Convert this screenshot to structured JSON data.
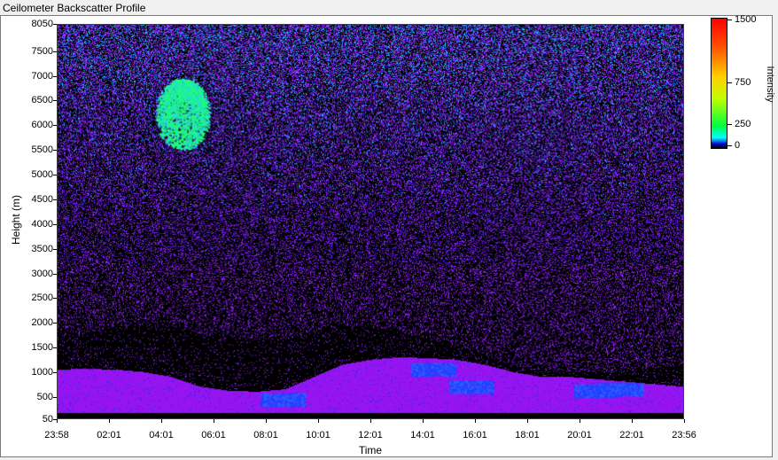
{
  "window": {
    "title": "Ceilometer Backscatter Profile"
  },
  "chart_data": {
    "type": "heatmap",
    "title": "Ceilometer Backscatter Profile",
    "xlabel": "Time",
    "ylabel": "Height (m)",
    "x_ticks": [
      "23:58",
      "02:01",
      "04:01",
      "06:01",
      "08:01",
      "10:01",
      "12:01",
      "14:01",
      "16:01",
      "18:01",
      "20:01",
      "22:01",
      "23:56"
    ],
    "y_ticks": [
      "8050",
      "7500",
      "7000",
      "6500",
      "6000",
      "5500",
      "5000",
      "4500",
      "4000",
      "3500",
      "3000",
      "2500",
      "2000",
      "1500",
      "1000",
      "500",
      "50"
    ],
    "ylim": [
      50,
      8050
    ],
    "colorbar": {
      "label": "Intensity",
      "ticks": [
        "1500",
        "750",
        "250",
        "0"
      ],
      "range": [
        0,
        1500
      ],
      "colors": [
        "#000000",
        "#0000c8",
        "#00ffff",
        "#00ff40",
        "#c0ff00",
        "#ffd000",
        "#ff5000",
        "#ff0000"
      ]
    },
    "features": {
      "boundary_layer_top_m": [
        1050,
        1060,
        1050,
        1000,
        900,
        700,
        620,
        600,
        650,
        900,
        1150,
        1250,
        1300,
        1280,
        1250,
        1150,
        1000,
        900,
        900,
        850,
        800,
        750,
        700
      ],
      "background_intensity": 150,
      "boundary_layer_intensity": 180,
      "cloud_intensity": 300
    }
  }
}
